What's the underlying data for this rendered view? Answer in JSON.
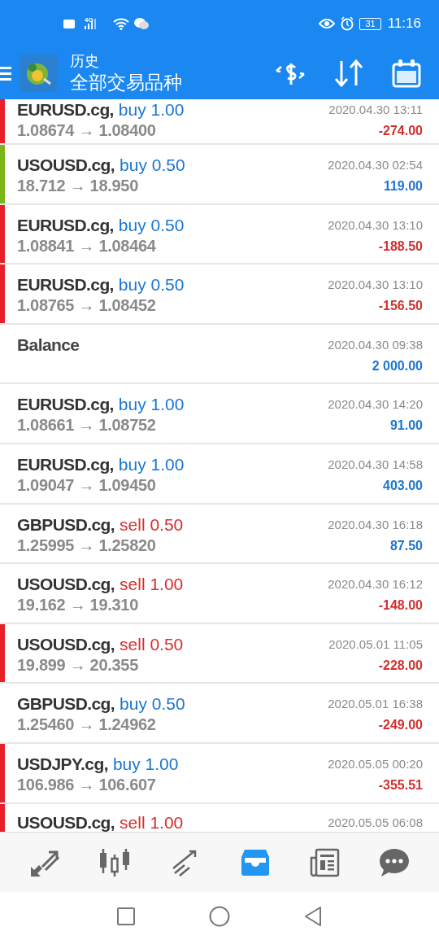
{
  "status_bar": {
    "network": "4G",
    "battery": "31",
    "time": "11:16"
  },
  "header": {
    "title": "历史",
    "subtitle": "全部交易品种"
  },
  "trades": [
    {
      "kind": "buy",
      "symbol": "EURUSD.cg,",
      "side": "buy 1.00",
      "prices": "1.08674 → 1.08400",
      "time": "2020.04.30 13:11",
      "profit": "-274.00",
      "loss": true,
      "color": "#e8202a"
    },
    {
      "kind": "buy",
      "symbol": "USOUSD.cg,",
      "side": "buy 0.50",
      "prices": "18.712 → 18.950",
      "time": "2020.04.30 02:54",
      "profit": "119.00",
      "loss": false,
      "color": "#7cb518"
    },
    {
      "kind": "buy",
      "symbol": "EURUSD.cg,",
      "side": "buy 0.50",
      "prices": "1.08841 → 1.08464",
      "time": "2020.04.30 13:10",
      "profit": "-188.50",
      "loss": true,
      "color": "#e8202a"
    },
    {
      "kind": "buy",
      "symbol": "EURUSD.cg,",
      "side": "buy 0.50",
      "prices": "1.08765 → 1.08452",
      "time": "2020.04.30 13:10",
      "profit": "-156.50",
      "loss": true,
      "color": "#e8202a"
    },
    {
      "kind": "balance",
      "symbol": "Balance",
      "time": "2020.04.30 09:38",
      "profit": "2 000.00",
      "loss": false
    },
    {
      "kind": "buy",
      "symbol": "EURUSD.cg,",
      "side": "buy 1.00",
      "prices": "1.08661 → 1.08752",
      "time": "2020.04.30 14:20",
      "profit": "91.00",
      "loss": false
    },
    {
      "kind": "buy",
      "symbol": "EURUSD.cg,",
      "side": "buy 1.00",
      "prices": "1.09047 → 1.09450",
      "time": "2020.04.30 14:58",
      "profit": "403.00",
      "loss": false
    },
    {
      "kind": "sell",
      "symbol": "GBPUSD.cg,",
      "side": "sell 0.50",
      "prices": "1.25995 → 1.25820",
      "time": "2020.04.30 16:18",
      "profit": "87.50",
      "loss": false
    },
    {
      "kind": "sell",
      "symbol": "USOUSD.cg,",
      "side": "sell 1.00",
      "prices": "19.162 → 19.310",
      "time": "2020.04.30 16:12",
      "profit": "-148.00",
      "loss": true
    },
    {
      "kind": "sell",
      "symbol": "USOUSD.cg,",
      "side": "sell 0.50",
      "prices": "19.899 → 20.355",
      "time": "2020.05.01 11:05",
      "profit": "-228.00",
      "loss": true,
      "color": "#e8202a"
    },
    {
      "kind": "buy",
      "symbol": "GBPUSD.cg,",
      "side": "buy 0.50",
      "prices": "1.25460 → 1.24962",
      "time": "2020.05.01 16:38",
      "profit": "-249.00",
      "loss": true
    },
    {
      "kind": "buy",
      "symbol": "USDJPY.cg,",
      "side": "buy 1.00",
      "prices": "106.986 → 106.607",
      "time": "2020.05.05 00:20",
      "profit": "-355.51",
      "loss": true,
      "color": "#e8202a"
    },
    {
      "kind": "sell",
      "symbol": "USOUSD.cg,",
      "side": "sell 1.00",
      "time": "2020.05.05 06:08",
      "color": "#e8202a"
    }
  ],
  "nav": [
    {
      "kind": "trade",
      "selected": false
    },
    {
      "kind": "chart",
      "selected": false
    },
    {
      "kind": "trend",
      "selected": false
    },
    {
      "kind": "history",
      "selected": true
    },
    {
      "kind": "news",
      "selected": false
    },
    {
      "kind": "chat",
      "selected": false
    }
  ]
}
